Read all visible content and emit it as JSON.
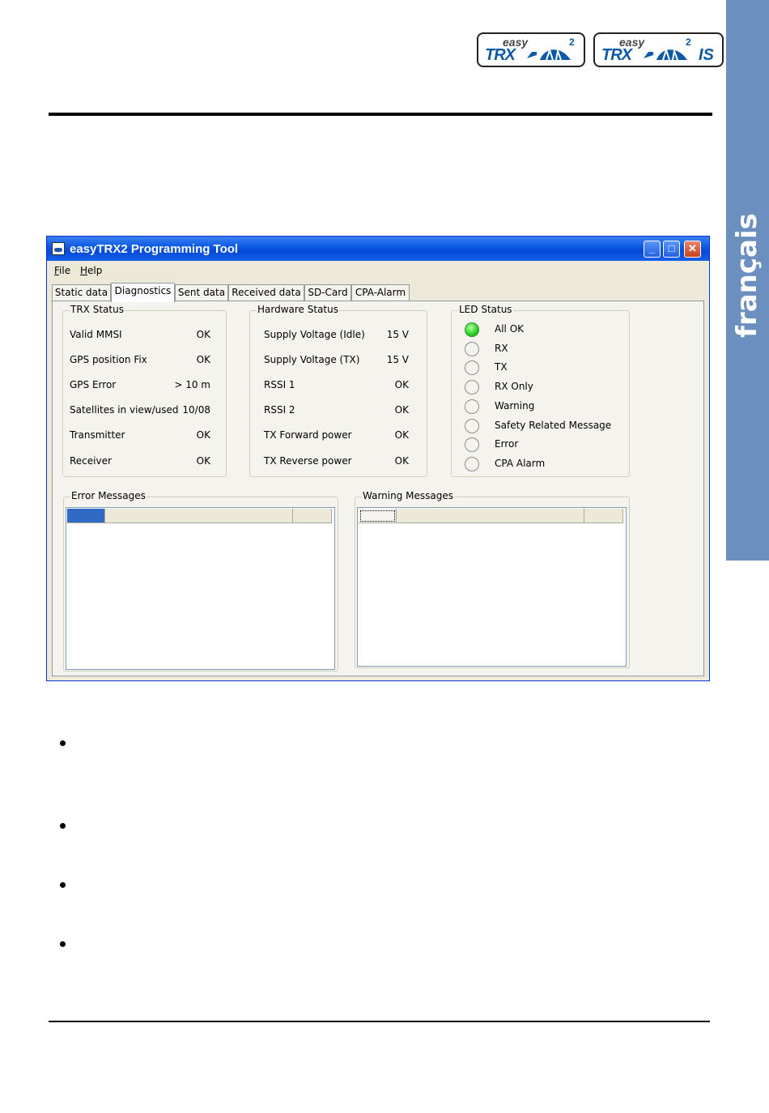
{
  "side_tab": {
    "label": "français",
    "color": "#6b8fbf"
  },
  "logos": [
    {
      "easy": "easy",
      "trx": "TRX",
      "sup": "2",
      "suffix": ""
    },
    {
      "easy": "easy",
      "trx": "TRX",
      "sup": "2",
      "suffix": "IS"
    }
  ],
  "window": {
    "title": "easyTRX2 Programming Tool",
    "menu": [
      "File",
      "Help"
    ],
    "tabs": [
      "Static data",
      "Diagnostics",
      "Sent data",
      "Received data",
      "SD-Card",
      "CPA-Alarm"
    ],
    "active_tab": "Diagnostics"
  },
  "trx_status": {
    "title": "TRX Status",
    "rows": [
      {
        "label": "Valid MMSI",
        "value": "OK"
      },
      {
        "label": "GPS position Fix",
        "value": "OK"
      },
      {
        "label": "GPS Error",
        "value": "> 10 m"
      },
      {
        "label": "Satellites in view/used",
        "value": "10/08"
      },
      {
        "label": "Transmitter",
        "value": "OK"
      },
      {
        "label": "Receiver",
        "value": "OK"
      }
    ]
  },
  "hardware_status": {
    "title": "Hardware Status",
    "rows": [
      {
        "label": "Supply Voltage (Idle)",
        "value": "15 V"
      },
      {
        "label": "Supply Voltage (TX)",
        "value": "15 V"
      },
      {
        "label": "RSSI 1",
        "value": "OK"
      },
      {
        "label": "RSSI 2",
        "value": "OK"
      },
      {
        "label": "TX Forward power",
        "value": "OK"
      },
      {
        "label": "TX Reverse power",
        "value": "OK"
      }
    ]
  },
  "led_status": {
    "title": "LED Status",
    "items": [
      {
        "label": "All OK",
        "on": true
      },
      {
        "label": "RX",
        "on": false
      },
      {
        "label": "TX",
        "on": false
      },
      {
        "label": "RX Only",
        "on": false
      },
      {
        "label": "Warning",
        "on": false
      },
      {
        "label": "Safety Related Message",
        "on": false
      },
      {
        "label": "Error",
        "on": false
      },
      {
        "label": "CPA Alarm",
        "on": false
      }
    ]
  },
  "error_messages": {
    "title": "Error Messages"
  },
  "warning_messages": {
    "title": "Warning Messages"
  },
  "colors": {
    "titlebar": "#0a58e2",
    "window_bg": "#ece9d8",
    "led_on": "#22d022"
  }
}
